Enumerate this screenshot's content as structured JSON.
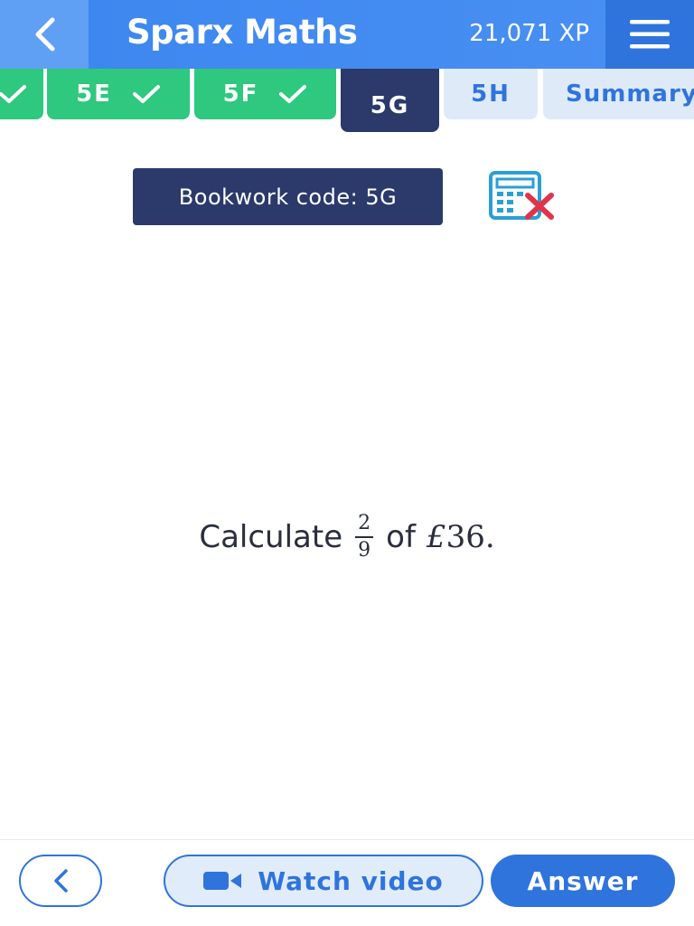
{
  "header": {
    "title": "Sparx Maths",
    "xp": "21,071 XP",
    "back_icon": "chevron-left-icon",
    "menu_icon": "hamburger-menu-icon"
  },
  "tabs": [
    {
      "label": "",
      "state": "done"
    },
    {
      "label": "5E",
      "state": "done"
    },
    {
      "label": "5F",
      "state": "done"
    },
    {
      "label": "5G",
      "state": "current"
    },
    {
      "label": "5H",
      "state": "todo"
    },
    {
      "label": "Summary",
      "state": "todo"
    }
  ],
  "bookwork": {
    "label": "Bookwork code: 5G",
    "calculator_icon": "calculator-not-allowed-icon"
  },
  "question": {
    "prefix": "Calculate",
    "fraction_numerator": "2",
    "fraction_denominator": "9",
    "middle": "of",
    "currency_symbol": "£",
    "amount": "36",
    "suffix": "."
  },
  "footer": {
    "watch_video_label": "Watch video",
    "answer_label": "Answer"
  },
  "colors": {
    "primary_blue": "#2f74dd",
    "header_blue": "#3b86f0",
    "done_green": "#2ec87e",
    "navy": "#2b3a6b",
    "todo_bg": "#dfeaf8",
    "calc_red": "#e0344a",
    "calc_blue": "#2a9fd6"
  }
}
